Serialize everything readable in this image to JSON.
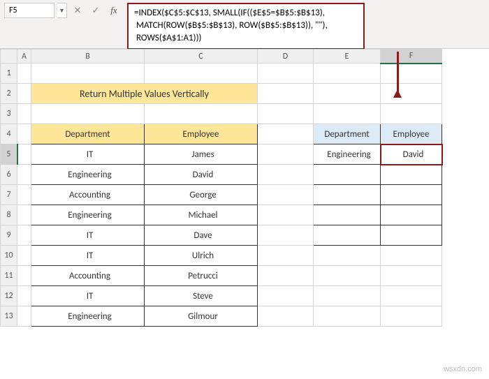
{
  "name_box": "F5",
  "formula": {
    "line1": "=INDEX($C$5:$C$13, SMALL(IF(($E$5=$B$5:$B$13),",
    "line2": " MATCH(ROW($B$5:$B$13), ROW($B$5:$B$13)), \"\"),",
    "line3": " ROWS($A$1:A1)))"
  },
  "columns": {
    "A": "A",
    "B": "B",
    "C": "C",
    "D": "D",
    "E": "E",
    "F": "F"
  },
  "rows": {
    "r1": "1",
    "r2": "2",
    "r3": "3",
    "r4": "4",
    "r5": "5",
    "r6": "6",
    "r7": "7",
    "r8": "8",
    "r9": "9",
    "r10": "10",
    "r11": "11",
    "r12": "12",
    "r13": "13"
  },
  "title": "Return Multiple Values Vertically",
  "main_table": {
    "hdr_dept": "Department",
    "hdr_emp": "Employee",
    "rows": [
      {
        "dept": "IT",
        "emp": "James"
      },
      {
        "dept": "Engineering",
        "emp": "David"
      },
      {
        "dept": "Accounting",
        "emp": "George"
      },
      {
        "dept": "Engineering",
        "emp": "Michael"
      },
      {
        "dept": "IT",
        "emp": "Dave"
      },
      {
        "dept": "IT",
        "emp": "Ulrich"
      },
      {
        "dept": "Accounting",
        "emp": "Petrucci"
      },
      {
        "dept": "IT",
        "emp": "Steve"
      },
      {
        "dept": "Engineering",
        "emp": "Gilmour"
      }
    ]
  },
  "side_table": {
    "hdr_dept": "Department",
    "hdr_emp": "Employee",
    "rows": [
      {
        "dept": "Engineering",
        "emp": "David"
      },
      {
        "dept": "",
        "emp": ""
      },
      {
        "dept": "",
        "emp": ""
      },
      {
        "dept": "",
        "emp": ""
      },
      {
        "dept": "",
        "emp": ""
      }
    ]
  },
  "watermark": "wsxdn.com"
}
